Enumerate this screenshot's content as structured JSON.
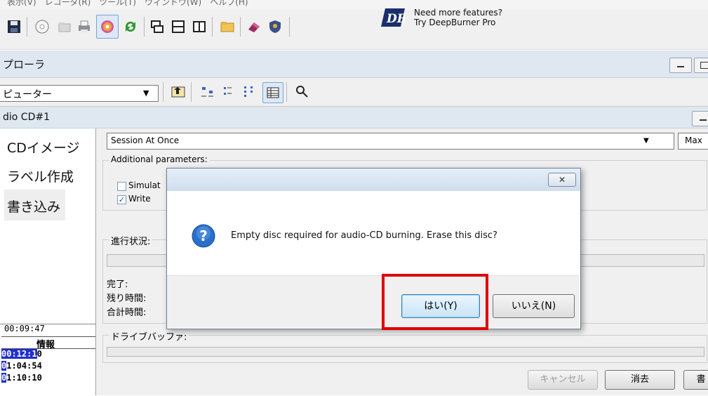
{
  "menubar": {
    "partial_text": "表示(V)　レコーダ(R)　ツール(T)　ウィンドウ(W)　ヘルプ(H)"
  },
  "toolbar": {
    "icons": [
      "save-icon",
      "disc-icon",
      "folder-icon",
      "print-icon",
      "burn-icon",
      "refresh-icon",
      "cascade-icon",
      "tile-horizontal-icon",
      "tile-vertical-icon",
      "open-folder-icon",
      "erase-icon",
      "shield-icon"
    ],
    "promo_line1": "Need more features?",
    "promo_line2": "Try DeepBurner Pro",
    "promo_logo": "DB"
  },
  "explorer": {
    "title": "プローラ",
    "location": "ピューター"
  },
  "project": {
    "title": "dio CD#1"
  },
  "nav": {
    "items": [
      "CDイメージ",
      "ラベル作成",
      "書き込み"
    ]
  },
  "info": {
    "elapsed": "00:09:47",
    "header": "情報",
    "rows": [
      {
        "hl": "00:12:1",
        "rest": "0"
      },
      {
        "hl": "0",
        "rest": "1:04:54"
      },
      {
        "hl": "0",
        "rest": "1:10:10"
      }
    ]
  },
  "settings": {
    "write_mode": "Session At Once",
    "speed": "Max",
    "additional_params_label": "Additional parameters:",
    "simulate_label": "Simulat",
    "write_label": "Write",
    "write_checked": true,
    "progress_label": "進行状況:",
    "done_label": "完了:",
    "remaining_label": "残り時間:",
    "total_label": "合計時間:",
    "buffer_label": "ドライブバッファ:"
  },
  "buttons": {
    "cancel": "キャンセル",
    "erase": "消去",
    "write_partial": "書"
  },
  "dialog": {
    "close_glyph": "✕",
    "message": "Empty disc required for audio-CD burning. Erase this disc?",
    "yes": "はい(Y)",
    "no": "いいえ(N)"
  },
  "colors": {
    "highlight_box": "#e00000",
    "panel_header": "#dfe7f1",
    "timestamp_highlight": "#1f2fd0"
  }
}
